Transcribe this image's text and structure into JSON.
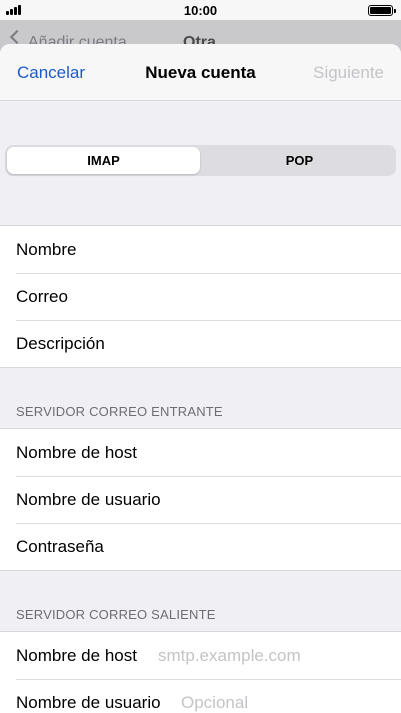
{
  "status_bar": {
    "time": "10:00"
  },
  "behind": {
    "back_label": "Añadir cuenta",
    "title": "Otra"
  },
  "navbar": {
    "cancel": "Cancelar",
    "title": "Nueva cuenta",
    "next": "Siguiente"
  },
  "segmented": {
    "options": [
      "IMAP",
      "POP"
    ],
    "selected": "IMAP"
  },
  "account_fields": [
    {
      "label": "Nombre"
    },
    {
      "label": "Correo"
    },
    {
      "label": "Descripción"
    }
  ],
  "incoming": {
    "header": "SERVIDOR CORREO ENTRANTE",
    "fields": [
      {
        "label": "Nombre de host"
      },
      {
        "label": "Nombre de usuario"
      },
      {
        "label": "Contraseña"
      }
    ]
  },
  "outgoing": {
    "header": "SERVIDOR CORREO SALIENTE",
    "fields": [
      {
        "label": "Nombre de host",
        "placeholder": "smtp.example.com"
      },
      {
        "label": "Nombre de usuario",
        "placeholder": "Opcional"
      }
    ]
  },
  "colors": {
    "accent": "#1e5bc6",
    "disabled": "#c4c4c8",
    "grouped_bg": "#efeff4"
  }
}
